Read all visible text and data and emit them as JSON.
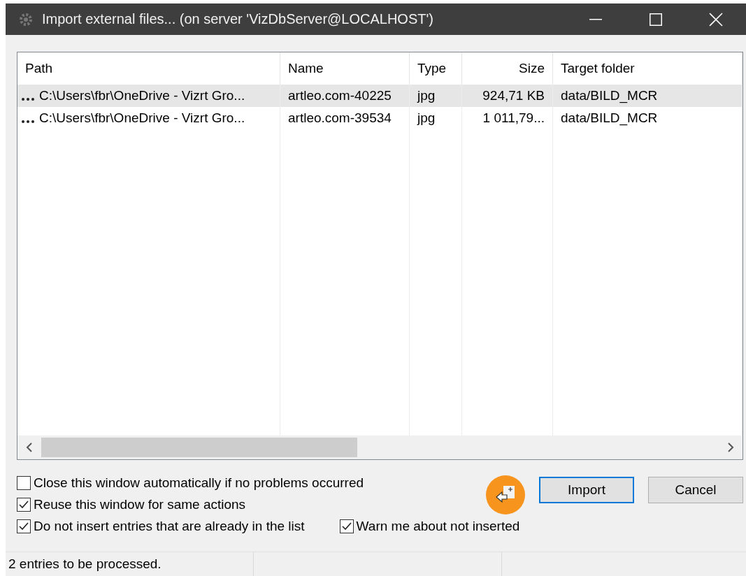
{
  "window": {
    "title": "Import external files... (on server 'VizDbServer@LOCALHOST')"
  },
  "table": {
    "columns": [
      {
        "label": "Path"
      },
      {
        "label": "Name"
      },
      {
        "label": "Type"
      },
      {
        "label": "Size"
      },
      {
        "label": "Target folder"
      }
    ],
    "rows": [
      {
        "selected": true,
        "cells": [
          "C:\\Users\\fbr\\OneDrive - Vizrt Gro...",
          "artleo.com-40225",
          "jpg",
          "924,71 KB",
          "data/BILD_MCR"
        ]
      },
      {
        "selected": false,
        "cells": [
          "C:\\Users\\fbr\\OneDrive - Vizrt Gro...",
          "artleo.com-39534",
          "jpg",
          "1 011,79...",
          "data/BILD_MCR"
        ]
      }
    ]
  },
  "options": [
    {
      "label": "Close this window automatically if no problems occurred",
      "checked": false
    },
    {
      "label": "Reuse this window for same actions",
      "checked": true
    },
    {
      "label": "Do not insert entries that are already in the list",
      "checked": true
    },
    {
      "label": "Warn me about not inserted",
      "checked": true
    }
  ],
  "buttons": [
    {
      "label": "Import",
      "selected": true
    },
    {
      "label": "Cancel",
      "selected": false
    }
  ],
  "status_bar": [
    "2 entries to be processed."
  ]
}
